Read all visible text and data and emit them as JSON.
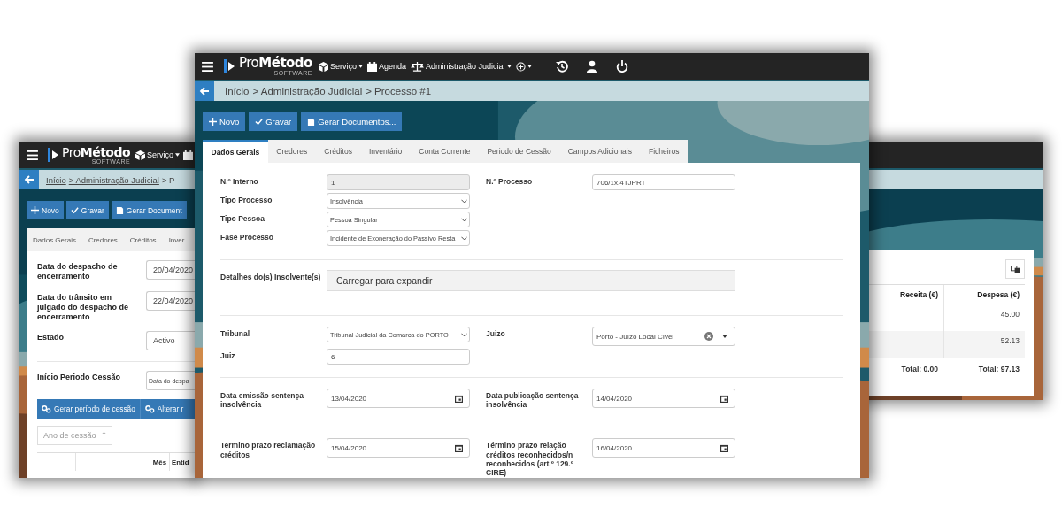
{
  "back_left_window": {
    "nav": {
      "logo": "Pro**Método**",
      "tagline": "SOFTWARE",
      "menus": [
        {
          "kind": "service",
          "label": "Serviço",
          "dropdown": true
        },
        {
          "kind": "agenda",
          "dropdown": false
        }
      ]
    },
    "breadcrumb": [
      {
        "label": "Início",
        "link": true
      },
      {
        "label": "> Administração Judicial",
        "link": true
      },
      {
        "label": "> P",
        "link": false
      }
    ],
    "buttons": [
      {
        "kind": "new",
        "label": "Novo"
      },
      {
        "kind": "save",
        "label": "Gravar"
      },
      {
        "kind": "docs",
        "label": "Gerar Document"
      }
    ],
    "tabs": [
      {
        "label": "Dados Gerais",
        "selected": false
      },
      {
        "label": "Credores",
        "selected": false
      },
      {
        "label": "Créditos",
        "selected": false
      },
      {
        "label": "Inver",
        "selected": false
      }
    ],
    "fields": [
      {
        "label": "Data do despacho de encerramento",
        "value": "20/04/2020"
      },
      {
        "label": "Data do trânsito em julgado do despacho de encerramento",
        "value": "22/04/2020"
      },
      {
        "label": "Estado",
        "value": "Activo"
      }
    ],
    "period": {
      "label": "Início Periodo Cessão",
      "value": "Data do despa"
    },
    "actions": [
      {
        "label": "Gerar período de cessão"
      },
      {
        "label": "Alterar r"
      }
    ],
    "sort_field": {
      "placeholder": "Ano de cessão"
    },
    "table": {
      "columns": [
        {
          "label": "Mês"
        },
        {
          "label": "Entid"
        }
      ]
    }
  },
  "back_right_window": {
    "table": {
      "columns": [
        {
          "label": "Receita (€)"
        },
        {
          "label": "Despesa (€)"
        }
      ],
      "rows": [
        {
          "expense": "45.00"
        },
        {
          "expense": "52.13"
        }
      ],
      "totals": [
        "Total: 0.00",
        "Total: 97.13"
      ]
    }
  },
  "front_window": {
    "nav": {
      "logo": "Pro**Método**",
      "tagline": "SOFTWARE",
      "menus": [
        {
          "kind": "service",
          "label": "Serviço",
          "dropdown": true
        },
        {
          "kind": "agenda",
          "label": "Agenda",
          "dropdown": false
        },
        {
          "kind": "judicial",
          "label": "Administração Judicial",
          "dropdown": true
        },
        {
          "kind": "add",
          "dropdown": true
        }
      ]
    },
    "breadcrumb": [
      {
        "label": "Início",
        "link": true
      },
      {
        "label": "> Administração Judicial",
        "link": true
      },
      {
        "label": "> Processo #1",
        "link": false
      }
    ],
    "buttons": [
      {
        "kind": "new",
        "label": "Novo"
      },
      {
        "kind": "save",
        "label": "Gravar"
      },
      {
        "kind": "docs",
        "label": "Gerar Documentos..."
      }
    ],
    "tabs": [
      {
        "label": "Dados Gerais",
        "selected": true
      },
      {
        "label": "Credores",
        "selected": false
      },
      {
        "label": "Créditos",
        "selected": false
      },
      {
        "label": "Inventário",
        "selected": false
      },
      {
        "label": "Conta Corrente",
        "selected": false
      },
      {
        "label": "Periodo de Cessão",
        "selected": false
      },
      {
        "label": "Campos Adicionais",
        "selected": false
      },
      {
        "label": "Ficheiros",
        "selected": false
      }
    ],
    "sections": [
      {
        "rows": [
          {
            "fields": [
              {
                "label": "N.º Interno",
                "kind": "readonly",
                "value": "1"
              },
              {
                "label": "N.º Processo",
                "kind": "text",
                "value": "706/1x.4TJPRT"
              }
            ]
          },
          {
            "fields": [
              {
                "label": "Tipo Processo",
                "kind": "select",
                "value": "Insolvência"
              }
            ]
          },
          {
            "fields": [
              {
                "label": "Tipo Pessoa",
                "kind": "select",
                "value": "Pessoa Singular"
              }
            ]
          },
          {
            "fields": [
              {
                "label": "Fase Processo",
                "kind": "select",
                "value": "Incidente de Exoneração do Passivo Resta"
              }
            ]
          }
        ]
      },
      {
        "rows": [
          {
            "fields": [
              {
                "label": "Detalhes do(s) Insolvente(s)",
                "kind": "expand",
                "value": "Carregar para expandir"
              }
            ]
          }
        ]
      },
      {
        "rows": [
          {
            "fields": [
              {
                "label": "Tribunal",
                "kind": "select",
                "value": "Tribunal Judicial da Comarca do PORTO"
              },
              {
                "label": "Juizo",
                "kind": "combo",
                "value": "Porto - Juízo Local Cível"
              }
            ]
          },
          {
            "fields": [
              {
                "label": "Juiz",
                "kind": "text",
                "value": "6"
              }
            ]
          }
        ]
      },
      {
        "rows": [
          {
            "fields": [
              {
                "label": "Data emissão sentença insolvência",
                "kind": "date",
                "value": "13/04/2020"
              },
              {
                "label": "Data publicação sentença insolvência",
                "kind": "date",
                "value": "14/04/2020"
              }
            ]
          },
          {
            "fields": [
              {
                "label": "Termino prazo reclamação créditos",
                "kind": "date",
                "value": "15/04/2020"
              },
              {
                "label": "Término prazo relação créditos reconhecidos/n reconhecidos (art.º 129.º CIRE)",
                "kind": "date",
                "value": "16/04/2020"
              }
            ]
          }
        ]
      }
    ]
  }
}
